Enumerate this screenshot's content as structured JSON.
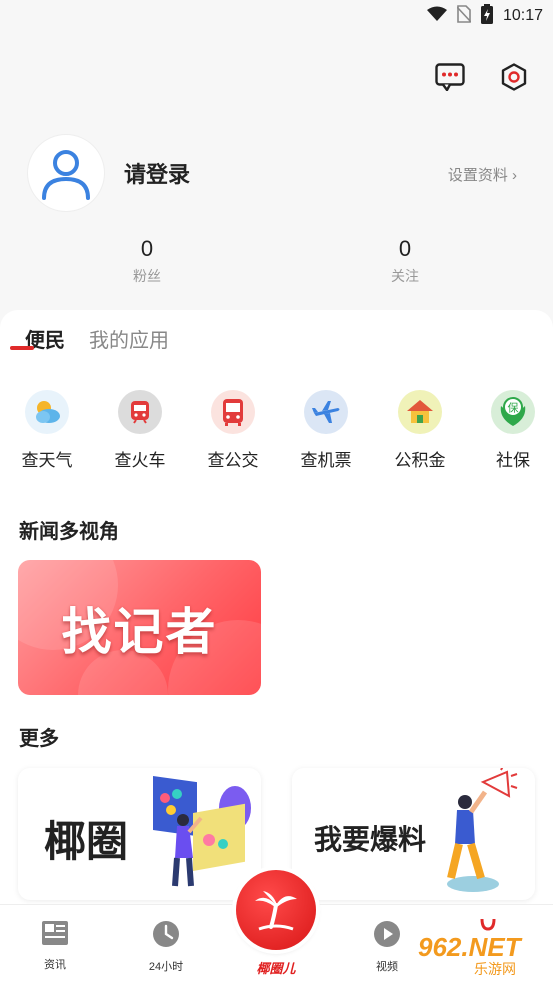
{
  "status_bar": {
    "time": "10:17",
    "icons": [
      "wifi-icon",
      "no-sim-icon",
      "battery-charging-icon"
    ]
  },
  "header": {
    "actions": [
      "message-icon",
      "settings-icon"
    ]
  },
  "profile": {
    "login_text": "请登录",
    "settings_link": "设置资料 ›"
  },
  "stats": [
    {
      "value": "0",
      "label": "粉丝"
    },
    {
      "value": "0",
      "label": "关注"
    }
  ],
  "tabs": [
    {
      "label": "便民",
      "active": true
    },
    {
      "label": "我的应用",
      "active": false
    }
  ],
  "services": [
    {
      "label": "查天气",
      "icon": "weather-icon",
      "bg": "#e8f3fb"
    },
    {
      "label": "查火车",
      "icon": "train-icon",
      "bg": "#dcdcdc"
    },
    {
      "label": "查公交",
      "icon": "bus-icon",
      "bg": "#fbe3df"
    },
    {
      "label": "查机票",
      "icon": "plane-icon",
      "bg": "#dbe6f5"
    },
    {
      "label": "公积金",
      "icon": "house-icon",
      "bg": "#f0f2b8"
    },
    {
      "label": "社保",
      "icon": "social-security-icon",
      "bg": "#d8eed8",
      "icon_text": "保"
    }
  ],
  "sections": {
    "news": "新闻多视角",
    "more": "更多"
  },
  "reporter_card": {
    "text": "找记者"
  },
  "more_cards": [
    {
      "text": "椰圈"
    },
    {
      "text": "我要爆料"
    }
  ],
  "bottom_nav": {
    "items": [
      {
        "label": "资讯",
        "icon": "news-icon"
      },
      {
        "label": "24小时",
        "icon": "clock-icon"
      },
      {
        "label": "视频",
        "icon": "video-play-icon"
      }
    ],
    "center_label": "椰圈儿"
  },
  "watermark": {
    "line1": "962.NET",
    "line2": "乐游网"
  },
  "colors": {
    "accent": "#e02a2a",
    "card_red": "#ff5a5e",
    "avatar_blue": "#3b82e0"
  }
}
